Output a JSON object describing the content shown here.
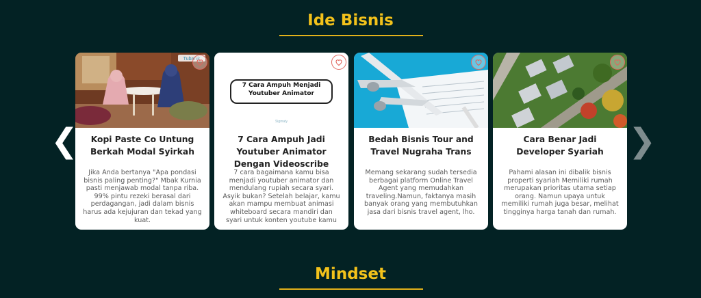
{
  "sections": {
    "ide_bisnis": {
      "title": "Ide Bisnis"
    },
    "mindset": {
      "title": "Mindset"
    }
  },
  "carousel": {
    "prev_icon": "❮",
    "next_icon": "❯",
    "cards": [
      {
        "image": "two women in hijab sitting at a cafe table",
        "logo_text": "Tubanik",
        "title": "Kopi Paste Co Untung Berkah Modal Syirkah",
        "excerpt": "Jika Anda bertanya \"Apa pondasi bisnis paling penting?\" Mbak Kurnia pasti menjawab modal tanpa riba. 99% pintu rezeki berasal dari perdagangan, jadi dalam bisnis harus ada kejujuran dan tekad yang kuat."
      },
      {
        "image": "text banner",
        "banner_text": "7 Cara Ampuh Menjadi Youtuber Animator",
        "logo_text": "Sigmaty",
        "title": "7 Cara Ampuh Jadi Youtuber Animator Dengan Videoscribe",
        "excerpt": "7 cara bagaimana kamu bisa menjadi youtuber animator dan mendulang rupiah secara syari. Asyik bukan? Setelah belajar, kamu akan mampu membuat animasi whiteboard secara mandiri dan syari untuk konten youtube kamu"
      },
      {
        "image": "model airplane over a travel form",
        "title": "Bedah Bisnis Tour and Travel Nugraha Trans",
        "excerpt": "Memang sekarang sudah tersedia berbagai platform Online Travel Agent yang memudahkan traveling.Namun, faktanya masih banyak orang yang membutuhkan jasa dari bisnis travel agent, lho."
      },
      {
        "image": "aerial view of a housing estate",
        "title": "Cara Benar Jadi Developer Syariah",
        "excerpt": "Pahami alasan ini dibalik bisnis properti syariah Memiliki rumah merupakan prioritas utama setiap orang. Namun upaya untuk memiliki rumah juga besar, melihat tingginya harga tanah dan rumah."
      }
    ]
  },
  "colors": {
    "background": "#032224",
    "title": "#f3c21b",
    "heart": "#e0675f"
  },
  "icons": [
    "chevron-left-icon",
    "chevron-right-icon",
    "heart-icon"
  ]
}
